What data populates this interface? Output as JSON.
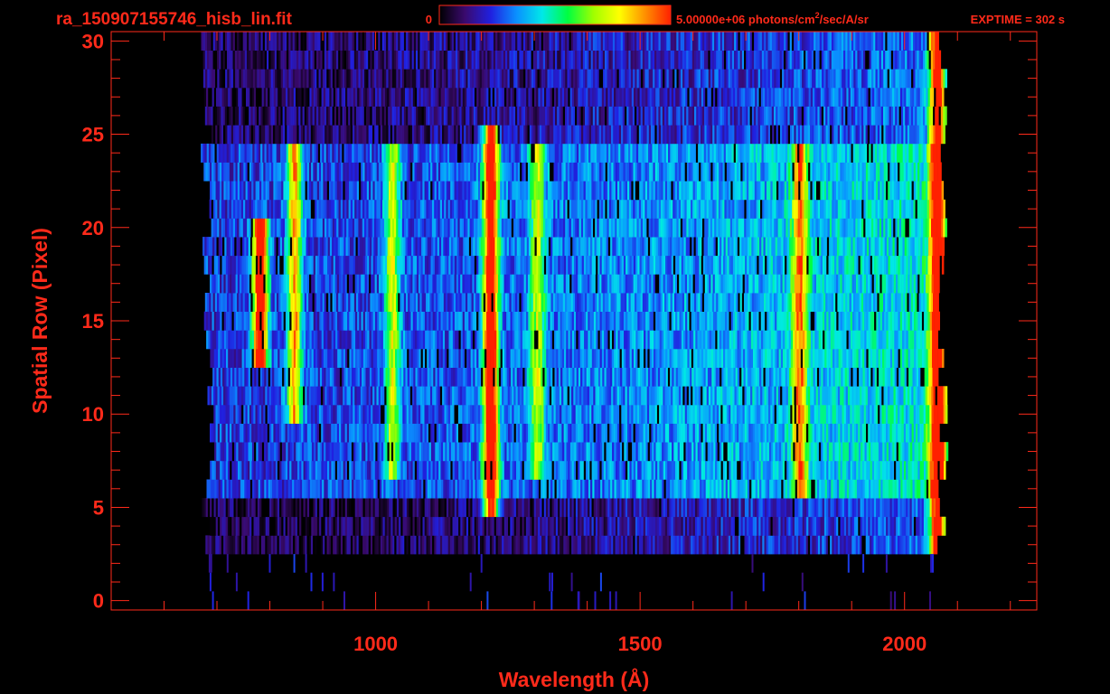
{
  "header": {
    "filename": "ra_150907155746_hisb_lin.fit",
    "colorbar_min_label": "0",
    "colorbar_max_prefix": "5.00000e+06 photons/cm",
    "colorbar_max_superscript": "2",
    "colorbar_max_suffix": "/sec/A/sr",
    "exptime_label": "EXPTIME = 302 s"
  },
  "colors": {
    "axis": "#ff2a1a",
    "background": "#000000",
    "colormap": [
      "#000000",
      "#3a0a6e",
      "#2020e0",
      "#0a90ff",
      "#00e8e8",
      "#00ff40",
      "#a0ff00",
      "#ffff00",
      "#ff9000",
      "#ff2000"
    ]
  },
  "chart_data": {
    "type": "heatmap",
    "title": "",
    "xlabel": "Wavelength (Å)",
    "ylabel": "Spatial Row (Pixel)",
    "xlim": [
      500,
      2250
    ],
    "ylim": [
      -0.5,
      30.5
    ],
    "x_ticks": [
      1000,
      1500,
      2000
    ],
    "x_tick_labels": [
      "1000",
      "1500",
      "2000"
    ],
    "y_ticks": [
      0,
      5,
      10,
      15,
      20,
      25,
      30
    ],
    "y_tick_labels": [
      "0",
      "5",
      "10",
      "15",
      "20",
      "25",
      "30"
    ],
    "colorbar": {
      "min": 0,
      "max": 5000000,
      "units": "photons/cm²/sec/A/sr"
    },
    "detector_extent": {
      "wavelength": [
        680,
        2070
      ],
      "rows": [
        3,
        30
      ]
    },
    "emission_features": [
      {
        "wavelength": 780,
        "rows": [
          13,
          20
        ],
        "level": 0.95
      },
      {
        "wavelength": 845,
        "rows": [
          10,
          24
        ],
        "level": 0.62
      },
      {
        "wavelength": 1030,
        "rows": [
          7,
          24
        ],
        "level": 0.45
      },
      {
        "wavelength": 1216,
        "rows": [
          5,
          25
        ],
        "level": 0.92
      },
      {
        "wavelength": 1304,
        "rows": [
          7,
          24
        ],
        "level": 0.42
      },
      {
        "wavelength": 1800,
        "rows": [
          6,
          24
        ],
        "level": 0.55
      },
      {
        "wavelength": 2060,
        "rows": [
          3,
          30
        ],
        "level": 0.85
      }
    ]
  }
}
